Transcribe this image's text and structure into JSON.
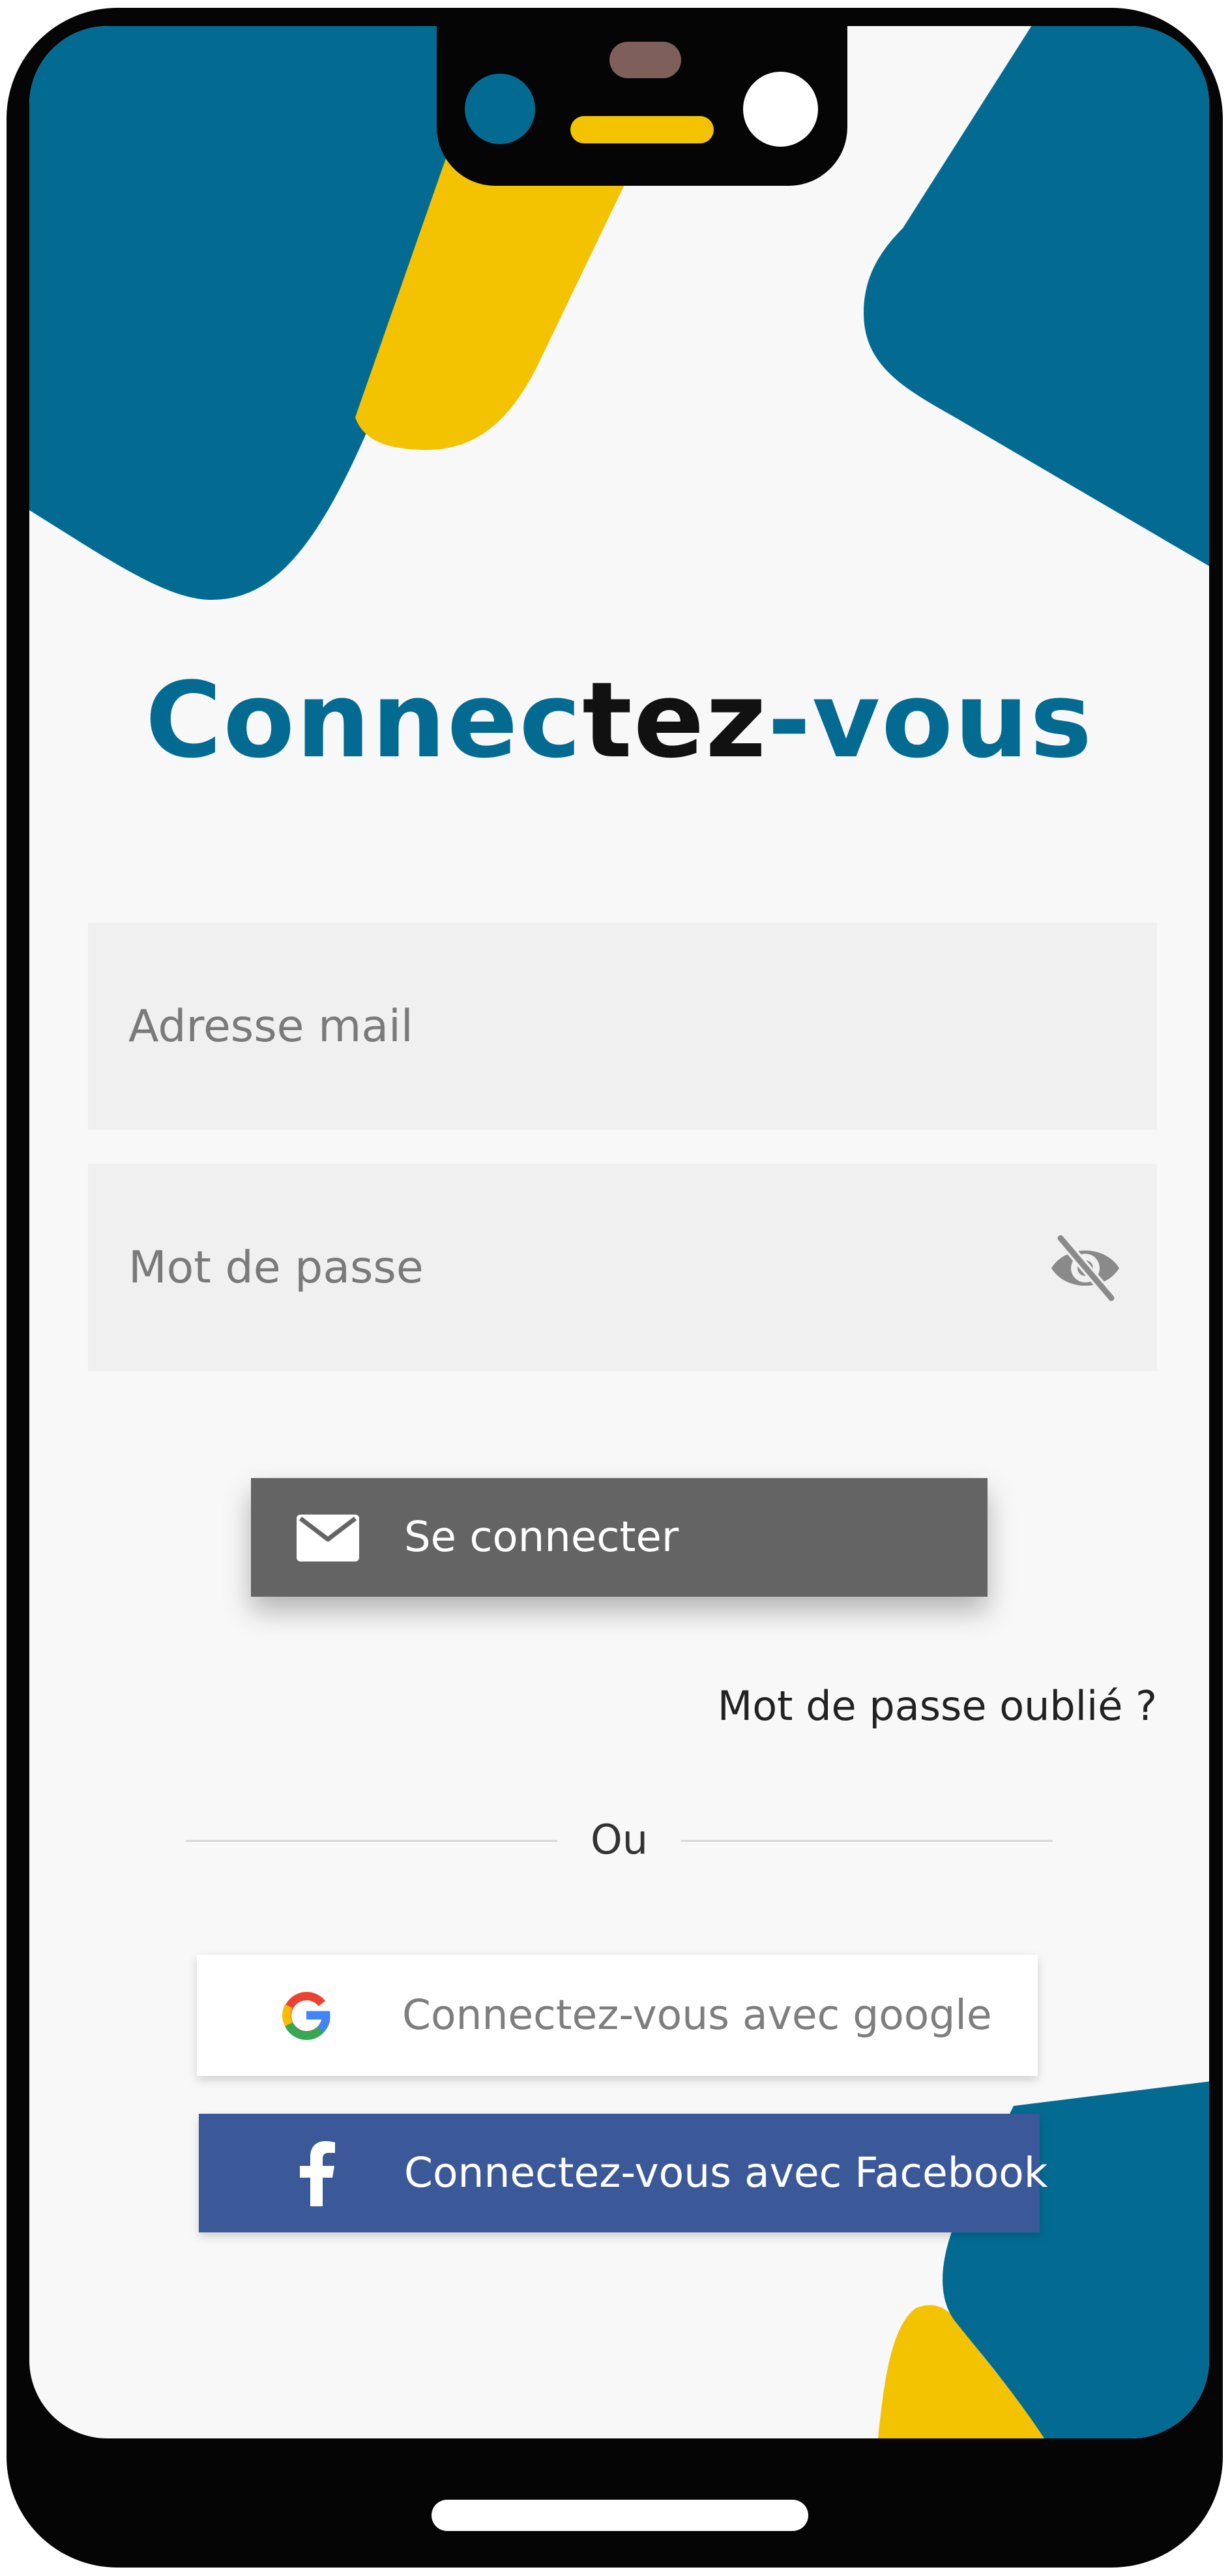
{
  "login": {
    "title": {
      "part1": "Connec",
      "part2": "tez",
      "part3": "-vous"
    },
    "email_placeholder": "Adresse mail",
    "password_placeholder": "Mot de passe",
    "password_toggle_icon": "eye-off-icon",
    "submit_label": "Se connecter",
    "submit_icon": "mail-icon",
    "forgot_password": "Mot de passe oublié ?",
    "separator": "Ou",
    "google_label": "Connectez-vous avec google",
    "google_icon": "google-icon",
    "facebook_label": "Connectez-vous avec Facebook",
    "facebook_icon": "facebook-icon"
  },
  "colors": {
    "primary_blue": "#036b92",
    "accent_yellow": "#f3c200",
    "button_gray": "#646464",
    "facebook_blue": "#3b5998",
    "field_bg": "#f0f0f0",
    "screen_bg": "#f8f8f8"
  }
}
